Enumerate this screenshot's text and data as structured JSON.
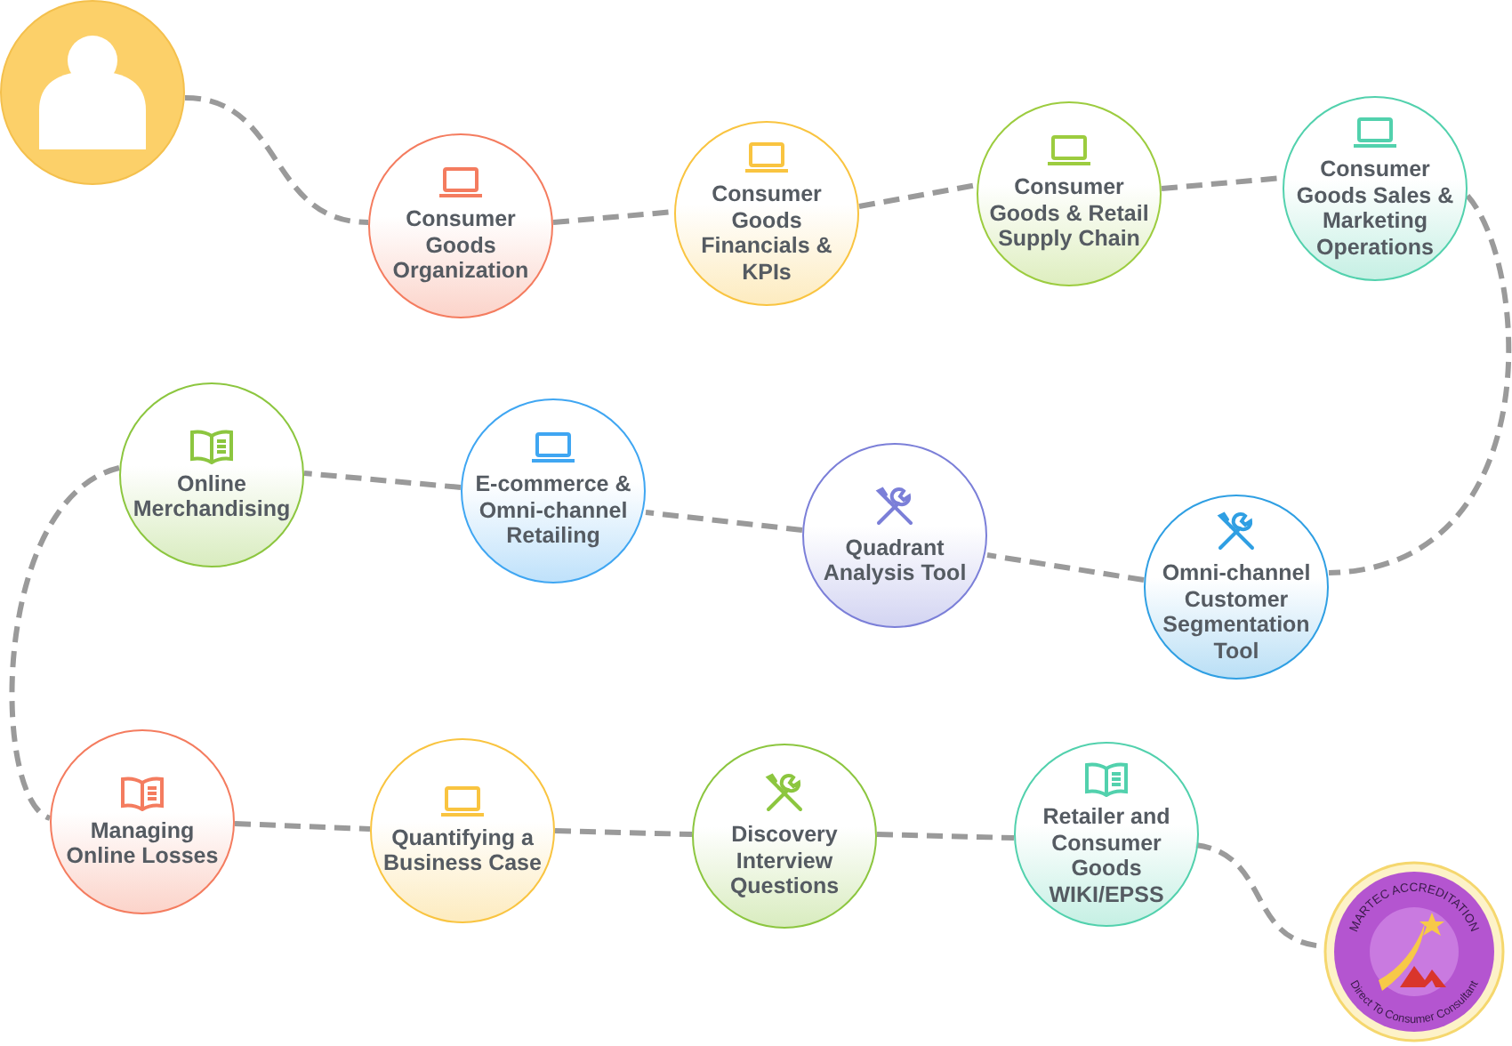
{
  "nodes": [
    {
      "label": "Consumer Goods Organization",
      "kind": "laptop",
      "color": "#f47c5f"
    },
    {
      "label": "Consumer Goods Financials & KPIs",
      "kind": "laptop",
      "color": "#f9c440"
    },
    {
      "label": "Consumer Goods & Retail Supply Chain",
      "kind": "laptop",
      "color": "#9ccc3f"
    },
    {
      "label": "Consumer Goods Sales & Marketing Operations",
      "kind": "laptop",
      "color": "#52d1ad"
    },
    {
      "label": "Online Merchandising",
      "kind": "book",
      "color": "#8cc63f"
    },
    {
      "label": "E-commerce & Omni-channel Retailing",
      "kind": "laptop",
      "color": "#3fa6f2"
    },
    {
      "label": "Quadrant Analysis Tool",
      "kind": "tools",
      "color": "#7b7fd8"
    },
    {
      "label": "Omni-channel Customer Segmentation Tool",
      "kind": "tools",
      "color": "#2f9fe3"
    },
    {
      "label": "Managing Online Losses",
      "kind": "book",
      "color": "#f47c5f"
    },
    {
      "label": "Quantifying a Business Case",
      "kind": "laptop",
      "color": "#f9c440"
    },
    {
      "label": "Discovery Interview Questions",
      "kind": "tools",
      "color": "#8cc63f"
    },
    {
      "label": "Retailer and Consumer Goods WIKI/EPSS",
      "kind": "book",
      "color": "#52d1ad"
    }
  ],
  "badge": {
    "top_text": "MARTEC ACCREDITATION",
    "bottom_text": "Direct To Consumer Consultant"
  }
}
